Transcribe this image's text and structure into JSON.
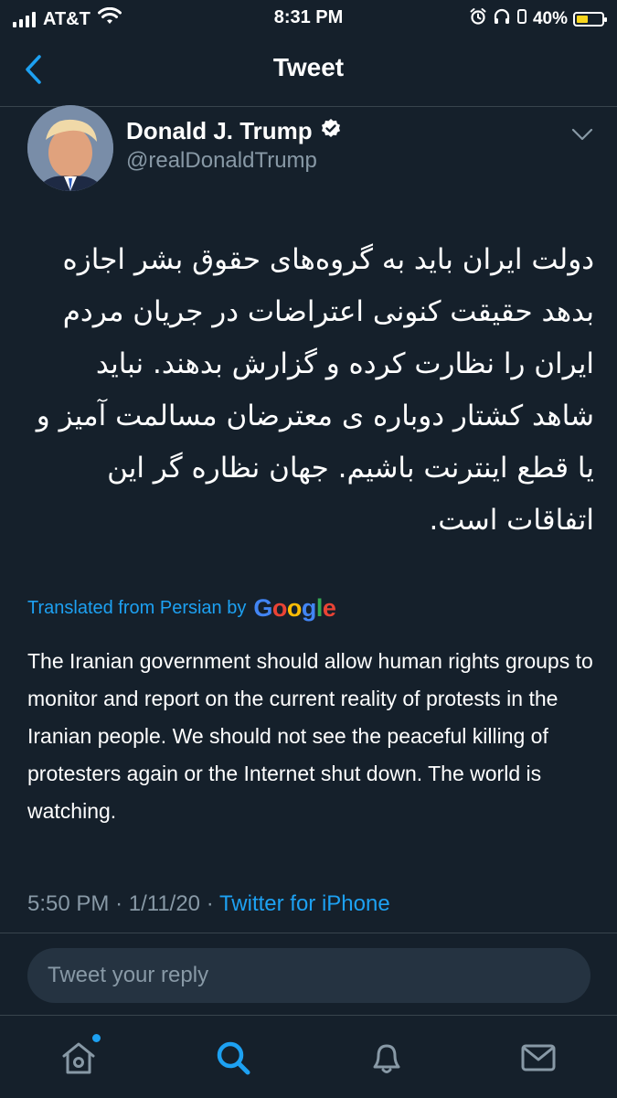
{
  "status_bar": {
    "carrier": "AT&T",
    "time": "8:31 PM",
    "battery": "40%"
  },
  "header": {
    "title": "Tweet"
  },
  "tweet": {
    "author_name": "Donald J. Trump",
    "author_handle": "@realDonaldTrump",
    "original_text": "دولت ایران باید به گروه‌های حقوق بشر اجازه بدهد حقیقت کنونی اعتراضات در جریان مردم ایران را نظارت کرده و گزارش بدهند. نباید شاهد کشتار دوباره ی معترضان مسالمت آمیز و یا قطع اینترنت باشیم. جهان نظاره گر این اتفاقات است.",
    "translated_label": "Translated from Persian by",
    "translation_provider": "Google",
    "translation": "The Iranian government should allow human rights groups to monitor and report on the current reality of protests in the Iranian people. We should not see the peaceful killing of protesters again or the Internet shut down. The world is watching.",
    "time": "5:50 PM",
    "separator": "·",
    "date": "1/11/20",
    "source": "Twitter for iPhone"
  },
  "reply": {
    "placeholder": "Tweet your reply"
  },
  "colors": {
    "background": "#15202b",
    "accent": "#1da1f2",
    "secondary_text": "#8899a6",
    "battery_fill": "#f7d51d"
  }
}
